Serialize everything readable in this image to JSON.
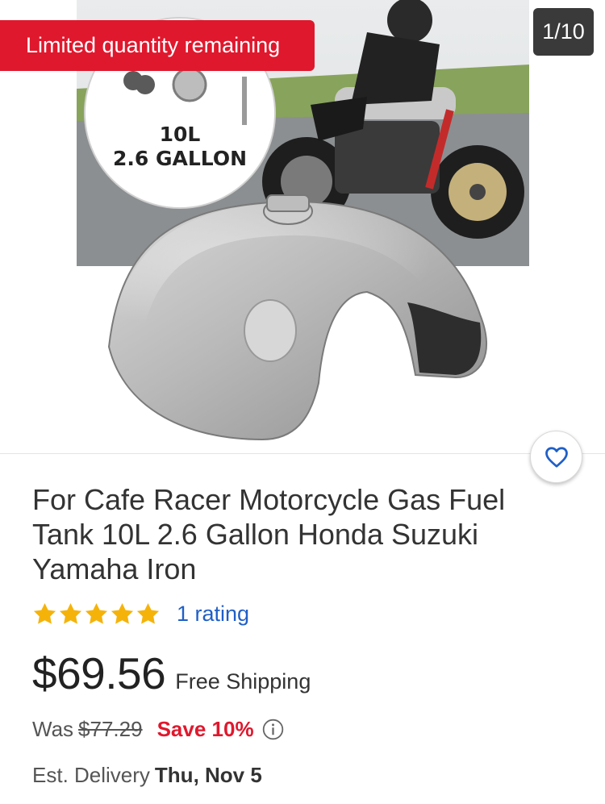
{
  "gallery": {
    "badge": "Limited quantity remaining",
    "counter": "1/10",
    "image_callout": {
      "line1": "10L",
      "line2": "2.6 GALLON"
    },
    "favorite_icon": "heart-icon"
  },
  "product": {
    "title": "For Cafe Racer Motorcycle Gas Fuel Tank 10L 2.6 Gallon Honda Suzuki Yamaha Iron",
    "rating": {
      "stars": 5,
      "max": 5,
      "text": "1 rating",
      "star_color": "#f5b30a"
    },
    "price": "$69.56",
    "shipping": "Free Shipping",
    "was_label": "Was",
    "was_price": "$77.29",
    "save": "Save 10%",
    "delivery_label": "Est. Delivery",
    "delivery_date": "Thu, Nov 5"
  },
  "colors": {
    "badge_red": "#e0182d",
    "link_blue": "#1f5fc7",
    "counter_bg": "#3a3a3a"
  }
}
